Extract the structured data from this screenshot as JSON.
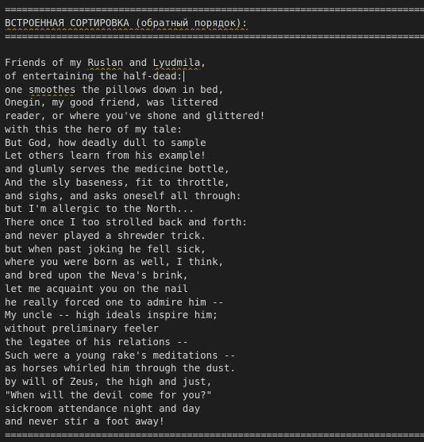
{
  "separator": "===============================================================================",
  "header": "ВСТРОЕННАЯ СОРТИРОВКА (обратный порядок):",
  "lines": [
    "Friends of my Ruslan and Lyudmila,",
    "of entertaining the half-dead:",
    "one smoothes the pillows down in bed,",
    "Onegin, my good friend, was littered",
    "reader, or where you've shone and glittered!",
    "with this the hero of my tale:",
    "But God, how deadly dull to sample",
    "Let others learn from his example!",
    "and glumly serves the medicine bottle,",
    "And the sly baseness, fit to throttle,",
    "and sighs, and asks oneself all through:",
    "but I'm allergic to the North...",
    "There once I too strolled back and forth:",
    "and never played a shrewder trick.",
    "but when past joking he fell sick,",
    "where you were born as well, I think,",
    "and bred upon the Neva's brink,",
    "let me acquaint you on the nail",
    "he really forced one to admire him --",
    "My uncle -- high ideals inspire him;",
    "without preliminary feeler",
    "the legatee of his relations --",
    "Such were a young rake's meditations --",
    "as horses whirled him through the dust.",
    "by will of Zeus, the high and just,",
    "\"When will the devil come for you?\"",
    "sickroom attendance night and day",
    "and never stir a foot away!"
  ]
}
